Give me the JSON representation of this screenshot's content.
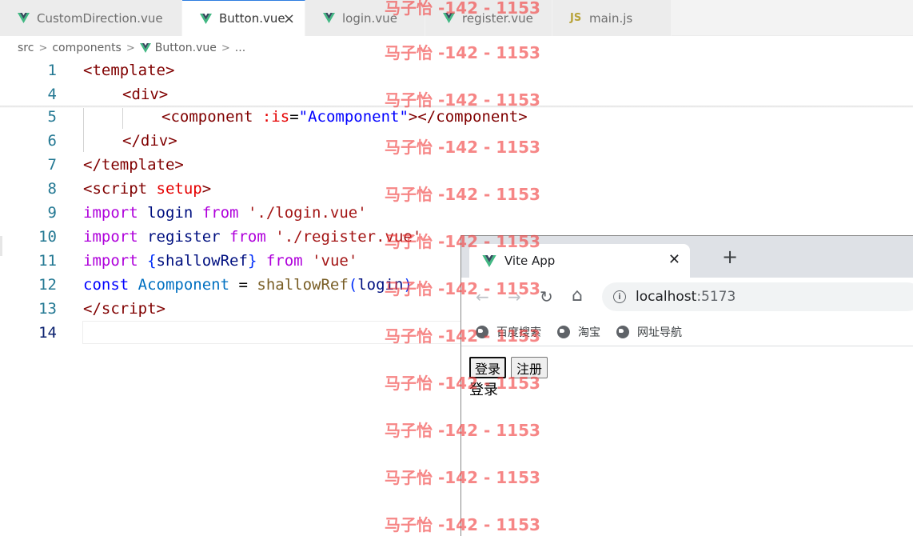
{
  "editor": {
    "tabs": [
      {
        "label": "CustomDirection.vue",
        "icon": "vue-icon",
        "active": false
      },
      {
        "label": "Button.vue",
        "icon": "vue-icon",
        "active": true
      },
      {
        "label": "login.vue",
        "icon": "vue-icon",
        "active": false
      },
      {
        "label": "register.vue",
        "icon": "vue-icon",
        "active": false
      },
      {
        "label": "main.js",
        "icon": "js-icon",
        "active": false
      }
    ],
    "js_icon_text": "JS",
    "tab_close": "×",
    "breadcrumb": {
      "src": "src",
      "components": "components",
      "file": "Button.vue",
      "more": "..."
    },
    "line_numbers": [
      "1",
      "4",
      "5",
      "6",
      "7",
      "8",
      "9",
      "10",
      "11",
      "12",
      "13",
      "14"
    ],
    "code": {
      "l1": [
        "<",
        "template",
        ">"
      ],
      "l4": [
        "<",
        "div",
        ">"
      ],
      "l5": [
        "<",
        "component",
        " ",
        ":is",
        "=",
        "\"Acomponent\"",
        "></",
        "component",
        ">"
      ],
      "l6": [
        "</",
        "div",
        ">"
      ],
      "l7": [
        "</",
        "template",
        ">"
      ],
      "l8": [
        "<",
        "script",
        " ",
        "setup",
        ">"
      ],
      "l9": [
        "import",
        " login ",
        "from",
        " ",
        "'./login.vue'"
      ],
      "l10": [
        "import",
        " register ",
        "from",
        " ",
        "'./register.vue'"
      ],
      "l11": [
        "import",
        " ",
        "{",
        "shallowRef",
        "}",
        " ",
        "from",
        " ",
        "'vue'"
      ],
      "l12": [
        "const",
        " ",
        "Acomponent",
        " = ",
        "shallowRef",
        "(",
        "login",
        ")"
      ],
      "l13": [
        "</",
        "script",
        ">"
      ]
    }
  },
  "browser": {
    "tab_title": "Vite App",
    "tab_close": "✕",
    "new_tab": "+",
    "nav": {
      "back": "←",
      "forward": "→",
      "reload": "↻",
      "home": "⌂"
    },
    "url_host": "localhost",
    "url_port": ":5173",
    "bookmarks": [
      "百度搜索",
      "淘宝",
      "网址导航"
    ],
    "page": {
      "buttons": [
        "登录",
        "注册"
      ],
      "component_text": "登录"
    }
  },
  "watermark": {
    "text": "马子怡 -142 - 1153"
  },
  "colors": {
    "vue_green": "#42b883",
    "vue_dark": "#35495e",
    "active_tab_border": "#2d7de0",
    "watermark": "#f03c3c"
  }
}
